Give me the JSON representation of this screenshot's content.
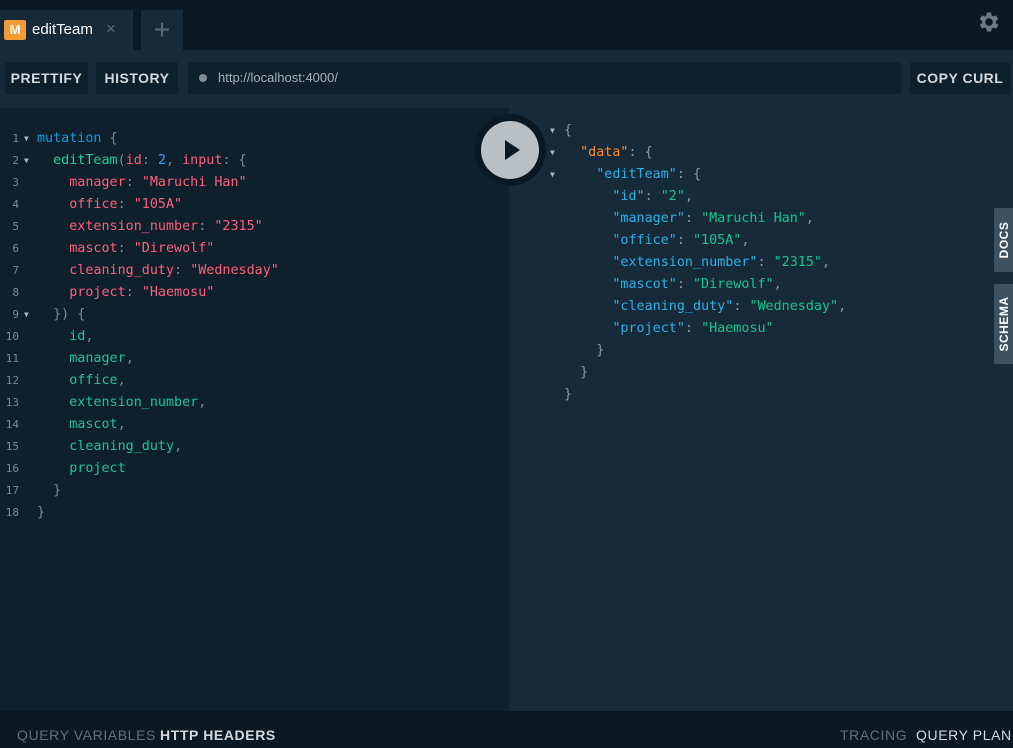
{
  "tab": {
    "badge": "M",
    "title": "editTeam",
    "close_glyph": "×",
    "new_tab_glyph": "+"
  },
  "toolbar": {
    "prettify": "PRETTIFY",
    "history": "HISTORY",
    "url": "http://localhost:4000/",
    "copy_curl": "COPY CURL"
  },
  "icons": {
    "settings": "gear-icon",
    "execute": "play-icon",
    "fold": "triangle-down-icon"
  },
  "query_lines": [
    {
      "n": "1",
      "fold": true,
      "tokens": [
        [
          "kw",
          "mutation"
        ],
        [
          "pun",
          " {"
        ]
      ]
    },
    {
      "n": "2",
      "fold": true,
      "tokens": [
        [
          "pun",
          "  "
        ],
        [
          "fn",
          "editTeam"
        ],
        [
          "pun",
          "("
        ],
        [
          "arg",
          "id"
        ],
        [
          "pun",
          ": "
        ],
        [
          "num",
          "2"
        ],
        [
          "pun",
          ", "
        ],
        [
          "arg",
          "input"
        ],
        [
          "pun",
          ": {"
        ]
      ]
    },
    {
      "n": "3",
      "fold": false,
      "tokens": [
        [
          "pun",
          "    "
        ],
        [
          "arg",
          "manager"
        ],
        [
          "pun",
          ": "
        ],
        [
          "str",
          "\"Maruchi Han\""
        ]
      ]
    },
    {
      "n": "4",
      "fold": false,
      "tokens": [
        [
          "pun",
          "    "
        ],
        [
          "arg",
          "office"
        ],
        [
          "pun",
          ": "
        ],
        [
          "str",
          "\"105A\""
        ]
      ]
    },
    {
      "n": "5",
      "fold": false,
      "tokens": [
        [
          "pun",
          "    "
        ],
        [
          "arg",
          "extension_number"
        ],
        [
          "pun",
          ": "
        ],
        [
          "str",
          "\"2315\""
        ]
      ]
    },
    {
      "n": "6",
      "fold": false,
      "tokens": [
        [
          "pun",
          "    "
        ],
        [
          "arg",
          "mascot"
        ],
        [
          "pun",
          ": "
        ],
        [
          "str",
          "\"Direwolf\""
        ]
      ]
    },
    {
      "n": "7",
      "fold": false,
      "tokens": [
        [
          "pun",
          "    "
        ],
        [
          "arg",
          "cleaning_duty"
        ],
        [
          "pun",
          ": "
        ],
        [
          "str",
          "\"Wednesday\""
        ]
      ]
    },
    {
      "n": "8",
      "fold": false,
      "tokens": [
        [
          "pun",
          "    "
        ],
        [
          "arg",
          "project"
        ],
        [
          "pun",
          ": "
        ],
        [
          "str",
          "\"Haemosu\""
        ]
      ]
    },
    {
      "n": "9",
      "fold": true,
      "tokens": [
        [
          "pun",
          "  }) {"
        ]
      ]
    },
    {
      "n": "10",
      "fold": false,
      "tokens": [
        [
          "pun",
          "    "
        ],
        [
          "fld",
          "id"
        ],
        [
          "pun",
          ","
        ]
      ]
    },
    {
      "n": "11",
      "fold": false,
      "tokens": [
        [
          "pun",
          "    "
        ],
        [
          "fld",
          "manager"
        ],
        [
          "pun",
          ","
        ]
      ]
    },
    {
      "n": "12",
      "fold": false,
      "tokens": [
        [
          "pun",
          "    "
        ],
        [
          "fld",
          "office"
        ],
        [
          "pun",
          ","
        ]
      ]
    },
    {
      "n": "13",
      "fold": false,
      "tokens": [
        [
          "pun",
          "    "
        ],
        [
          "fld",
          "extension_number"
        ],
        [
          "pun",
          ","
        ]
      ]
    },
    {
      "n": "14",
      "fold": false,
      "tokens": [
        [
          "pun",
          "    "
        ],
        [
          "fld",
          "mascot"
        ],
        [
          "pun",
          ","
        ]
      ]
    },
    {
      "n": "15",
      "fold": false,
      "tokens": [
        [
          "pun",
          "    "
        ],
        [
          "fld",
          "cleaning_duty"
        ],
        [
          "pun",
          ","
        ]
      ]
    },
    {
      "n": "16",
      "fold": false,
      "tokens": [
        [
          "pun",
          "    "
        ],
        [
          "fld",
          "project"
        ]
      ]
    },
    {
      "n": "17",
      "fold": false,
      "tokens": [
        [
          "pun",
          "  }"
        ]
      ]
    },
    {
      "n": "18",
      "fold": false,
      "tokens": [
        [
          "pun",
          "}"
        ]
      ]
    }
  ],
  "result_lines": [
    {
      "fold": true,
      "tokens": [
        [
          "pun2",
          "{"
        ]
      ]
    },
    {
      "fold": true,
      "tokens": [
        [
          "pun2",
          "  "
        ],
        [
          "jkey-data",
          "\"data\""
        ],
        [
          "pun2",
          ": {"
        ]
      ]
    },
    {
      "fold": true,
      "tokens": [
        [
          "pun2",
          "    "
        ],
        [
          "jkey",
          "\"editTeam\""
        ],
        [
          "pun2",
          ": {"
        ]
      ]
    },
    {
      "fold": false,
      "tokens": [
        [
          "pun2",
          "      "
        ],
        [
          "jkey",
          "\"id\""
        ],
        [
          "pun2",
          ": "
        ],
        [
          "jstr",
          "\"2\""
        ],
        [
          "pun2",
          ","
        ]
      ]
    },
    {
      "fold": false,
      "tokens": [
        [
          "pun2",
          "      "
        ],
        [
          "jkey",
          "\"manager\""
        ],
        [
          "pun2",
          ": "
        ],
        [
          "jstr",
          "\"Maruchi Han\""
        ],
        [
          "pun2",
          ","
        ]
      ]
    },
    {
      "fold": false,
      "tokens": [
        [
          "pun2",
          "      "
        ],
        [
          "jkey",
          "\"office\""
        ],
        [
          "pun2",
          ": "
        ],
        [
          "jstr",
          "\"105A\""
        ],
        [
          "pun2",
          ","
        ]
      ]
    },
    {
      "fold": false,
      "tokens": [
        [
          "pun2",
          "      "
        ],
        [
          "jkey",
          "\"extension_number\""
        ],
        [
          "pun2",
          ": "
        ],
        [
          "jstr",
          "\"2315\""
        ],
        [
          "pun2",
          ","
        ]
      ]
    },
    {
      "fold": false,
      "tokens": [
        [
          "pun2",
          "      "
        ],
        [
          "jkey",
          "\"mascot\""
        ],
        [
          "pun2",
          ": "
        ],
        [
          "jstr",
          "\"Direwolf\""
        ],
        [
          "pun2",
          ","
        ]
      ]
    },
    {
      "fold": false,
      "tokens": [
        [
          "pun2",
          "      "
        ],
        [
          "jkey",
          "\"cleaning_duty\""
        ],
        [
          "pun2",
          ": "
        ],
        [
          "jstr",
          "\"Wednesday\""
        ],
        [
          "pun2",
          ","
        ]
      ]
    },
    {
      "fold": false,
      "tokens": [
        [
          "pun2",
          "      "
        ],
        [
          "jkey",
          "\"project\""
        ],
        [
          "pun2",
          ": "
        ],
        [
          "jstr",
          "\"Haemosu\""
        ]
      ]
    },
    {
      "fold": false,
      "tokens": [
        [
          "pun2",
          "    }"
        ]
      ]
    },
    {
      "fold": false,
      "tokens": [
        [
          "pun2",
          "  }"
        ]
      ]
    },
    {
      "fold": false,
      "tokens": [
        [
          "pun2",
          "}"
        ]
      ]
    }
  ],
  "sidetabs": {
    "docs": "DOCS",
    "schema": "SCHEMA"
  },
  "bottom": {
    "query_variables": "QUERY VARIABLES",
    "http_headers": "HTTP HEADERS",
    "tracing": "TRACING",
    "query_plan": "QUERY PLAN"
  }
}
